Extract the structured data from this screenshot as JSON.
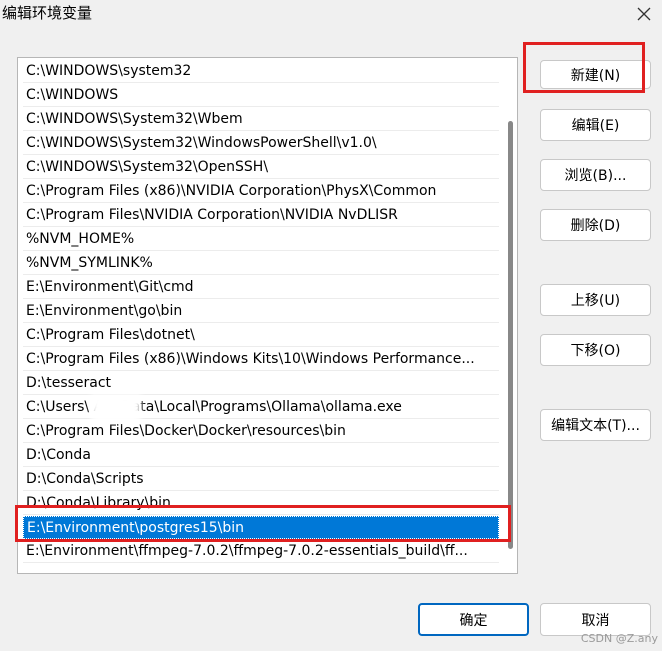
{
  "window": {
    "title": "编辑环境变量",
    "close_icon": "close-icon"
  },
  "path_list": {
    "items": [
      "C:\\WINDOWS\\system32",
      "C:\\WINDOWS",
      "C:\\WINDOWS\\System32\\Wbem",
      "C:\\WINDOWS\\System32\\WindowsPowerShell\\v1.0\\",
      "C:\\WINDOWS\\System32\\OpenSSH\\",
      "C:\\Program Files (x86)\\NVIDIA Corporation\\PhysX\\Common",
      "C:\\Program Files\\NVIDIA Corporation\\NVIDIA NvDLISR",
      "%NVM_HOME%",
      "%NVM_SYMLINK%",
      "E:\\Environment\\Git\\cmd",
      "E:\\Environment\\go\\bin",
      "C:\\Program Files\\dotnet\\",
      "C:\\Program Files (x86)\\Windows Kits\\10\\Windows Performance...",
      "D:\\tesseract",
      "C:\\Users\\        AppData\\Local\\Programs\\Ollama\\ollama.exe",
      "C:\\Program Files\\Docker\\Docker\\resources\\bin",
      "D:\\Conda",
      "D:\\Conda\\Scripts",
      "D:\\Conda\\Library\\bin",
      "E:\\Environment\\postgres15\\bin",
      "E:\\Environment\\ffmpeg-7.0.2\\ffmpeg-7.0.2-essentials_build\\ff..."
    ],
    "selected_index": 19
  },
  "buttons": {
    "new": "新建(N)",
    "edit": "编辑(E)",
    "browse": "浏览(B)...",
    "delete": "删除(D)",
    "move_up": "上移(U)",
    "move_down": "下移(O)",
    "edit_text": "编辑文本(T)...",
    "ok": "确定",
    "cancel": "取消"
  },
  "colors": {
    "selection": "#0078d7",
    "highlight": "#e02020"
  },
  "watermark": "CSDN @Z.any"
}
